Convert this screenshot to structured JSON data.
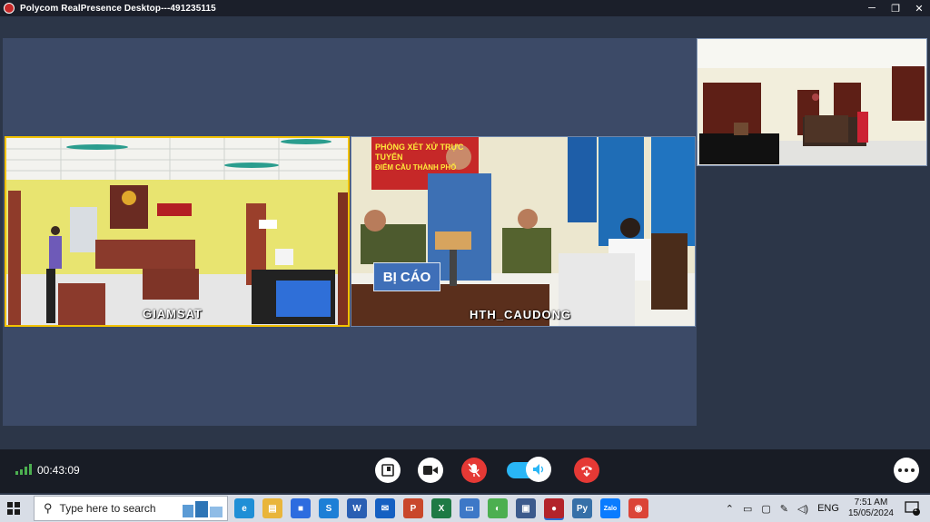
{
  "window": {
    "title": "Polycom RealPresence Desktop---491235115"
  },
  "tiles": {
    "giamsat": {
      "label": "GIAMSAT",
      "courtroom_banner": ""
    },
    "hth": {
      "label": "HTH_CAUDONG",
      "sign_text": "BỊ CÁO",
      "banner_text": "PHÒNG XÉT XỬ TRỰC TUYẾN",
      "banner_sub": "ĐIỂM CẦU THÀNH PHỐ"
    }
  },
  "controls": {
    "duration": "00:43:09",
    "icons": [
      "content-share-icon",
      "camera-icon",
      "microphone-muted-icon",
      "speaker-icon",
      "hangup-icon",
      "more-options-icon"
    ]
  },
  "taskbar": {
    "search_placeholder": "Type here to search",
    "apps": [
      {
        "name": "edge",
        "color": "#1f8fd6",
        "glyph": "e"
      },
      {
        "name": "file-explorer",
        "color": "#e9b53a",
        "glyph": "▤"
      },
      {
        "name": "store",
        "color": "#2d6cdf",
        "glyph": "■"
      },
      {
        "name": "skype-like",
        "color": "#1d7fd6",
        "glyph": "S"
      },
      {
        "name": "word",
        "color": "#2a5fb3",
        "glyph": "W"
      },
      {
        "name": "mail",
        "color": "#1560c2",
        "glyph": "✉"
      },
      {
        "name": "powerpoint",
        "color": "#c9472b",
        "glyph": "P"
      },
      {
        "name": "excel",
        "color": "#1e7a45",
        "glyph": "X"
      },
      {
        "name": "window-app",
        "color": "#3d78c7",
        "glyph": "▭"
      },
      {
        "name": "green-app",
        "color": "#4caf50",
        "glyph": "◐"
      },
      {
        "name": "remote-app",
        "color": "#3c5a8c",
        "glyph": "▣"
      },
      {
        "name": "polycom",
        "color": "#b3232a",
        "glyph": "●"
      },
      {
        "name": "python",
        "color": "#3770a8",
        "glyph": "Py"
      },
      {
        "name": "zalo",
        "color": "#0a7cff",
        "glyph": "Zalo"
      },
      {
        "name": "chrome",
        "color": "#db4437",
        "glyph": "◉"
      }
    ],
    "tray": {
      "language": "ENG",
      "time": "7:51 AM",
      "date": "15/05/2024",
      "notifications": "1"
    }
  },
  "colors": {
    "accent": "#29b6f6",
    "hangup": "#e53935",
    "active_tile_border": "#f2c200"
  }
}
